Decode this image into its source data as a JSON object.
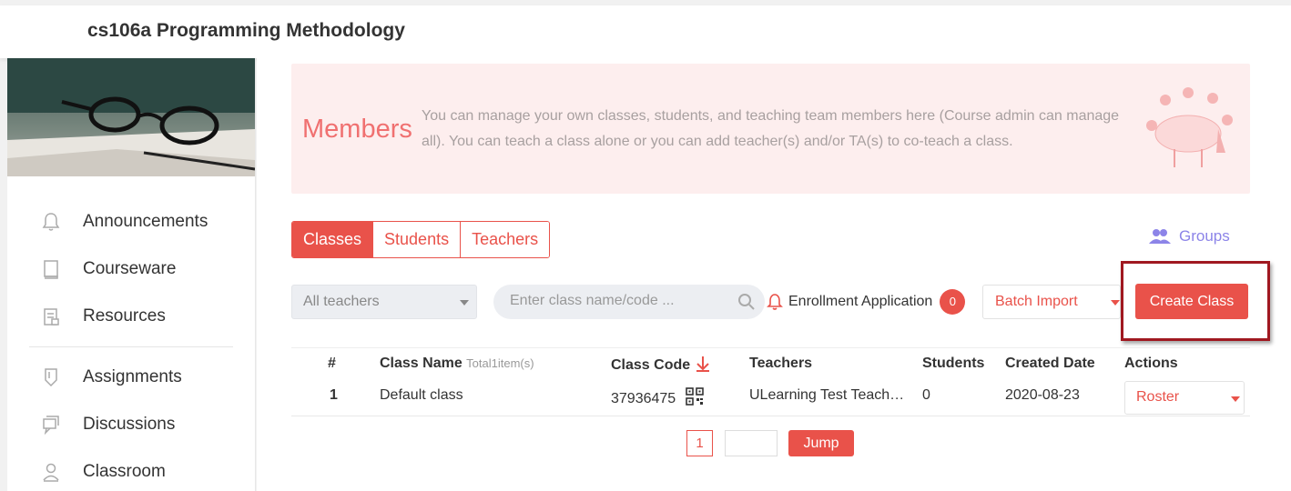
{
  "header": {
    "course_title": "cs106a Programming Methodology"
  },
  "sidebar": {
    "items": [
      {
        "label": "Announcements",
        "icon": "bell-icon"
      },
      {
        "label": "Courseware",
        "icon": "book-icon"
      },
      {
        "label": "Resources",
        "icon": "resources-icon"
      },
      {
        "label": "Assignments",
        "icon": "shield-icon"
      },
      {
        "label": "Discussions",
        "icon": "chat-icon"
      },
      {
        "label": "Classroom",
        "icon": "person-icon"
      }
    ]
  },
  "hero": {
    "title": "Members",
    "description": "You can manage your own classes, students, and teaching team members here (Course admin can manage all). You can teach a class alone or you can add teacher(s) and/or TA(s) to co-teach a class."
  },
  "tabs": [
    {
      "label": "Classes",
      "active": true
    },
    {
      "label": "Students",
      "active": false
    },
    {
      "label": "Teachers",
      "active": false
    }
  ],
  "groups_label": "Groups",
  "toolbar": {
    "teachers_select": "All teachers",
    "search_placeholder": "Enter class name/code ...",
    "enrollment_label": "Enrollment Application",
    "enrollment_count": "0",
    "batch_import": "Batch Import",
    "create_class": "Create Class"
  },
  "table": {
    "headers": {
      "num": "#",
      "class_name": "Class Name",
      "total": "Total1item(s)",
      "class_code": "Class Code",
      "teachers": "Teachers",
      "students": "Students",
      "created_date": "Created Date",
      "actions": "Actions"
    },
    "rows": [
      {
        "num": "1",
        "class_name": "Default class",
        "class_code": "37936475",
        "teachers": "ULearning Test Teach…",
        "students": "0",
        "created_date": "2020-08-23",
        "action": "Roster"
      }
    ]
  },
  "pagination": {
    "current_page": "1",
    "jump_label": "Jump"
  },
  "colors": {
    "accent": "#e9524a",
    "groups": "#8c84e8",
    "hero_bg": "#fdeeee",
    "highlight": "#a01820"
  }
}
